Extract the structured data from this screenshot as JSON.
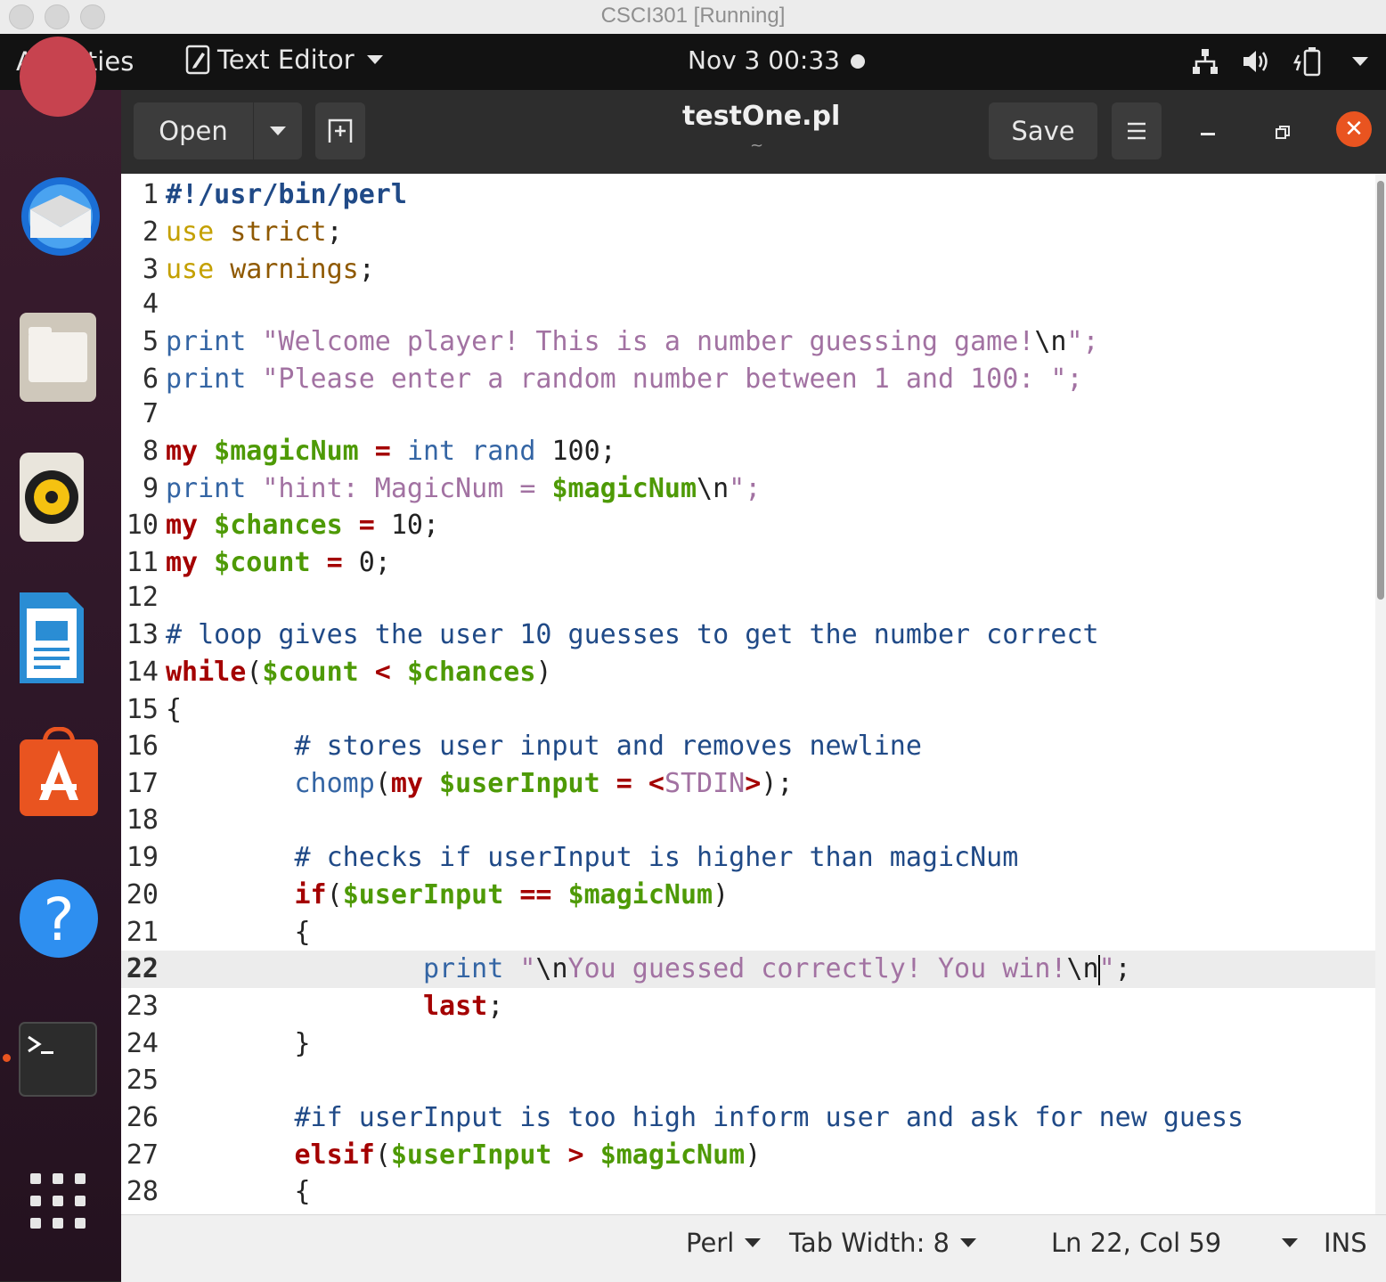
{
  "window": {
    "title": "CSCI301 [Running]"
  },
  "topbar": {
    "activities": "Activities",
    "app_name": "Text Editor",
    "clock": "Nov 3  00:33"
  },
  "header": {
    "open_label": "Open",
    "filename": "testOne.pl",
    "subtitle": "~",
    "save_label": "Save"
  },
  "editor": {
    "current_line": 22,
    "lines": [
      {
        "n": "1"
      },
      {
        "n": "2"
      },
      {
        "n": "3"
      },
      {
        "n": "4"
      },
      {
        "n": "5"
      },
      {
        "n": "6"
      },
      {
        "n": "7"
      },
      {
        "n": "8"
      },
      {
        "n": "9"
      },
      {
        "n": "10"
      },
      {
        "n": "11"
      },
      {
        "n": "12"
      },
      {
        "n": "13"
      },
      {
        "n": "14"
      },
      {
        "n": "15"
      },
      {
        "n": "16"
      },
      {
        "n": "17"
      },
      {
        "n": "18"
      },
      {
        "n": "19"
      },
      {
        "n": "20"
      },
      {
        "n": "21"
      },
      {
        "n": "22"
      },
      {
        "n": "23"
      },
      {
        "n": "24"
      },
      {
        "n": "25"
      },
      {
        "n": "26"
      },
      {
        "n": "27"
      },
      {
        "n": "28"
      }
    ],
    "tokens": {
      "l1": "#!/usr/bin/perl",
      "l2a": "use",
      "l2b": " strict",
      "l2c": ";",
      "l3a": "use",
      "l3b": " warnings",
      "l3c": ";",
      "l5a": "print",
      "l5b": " \"Welcome player! This is a number guessing game!",
      "l5c": "\\n",
      "l5d": "\";",
      "l6a": "print",
      "l6b": " \"Please enter a random number between 1 and 100: ",
      "l6c": "\";",
      "l8a": "my",
      "l8b": " $magicNum",
      "l8c": " = ",
      "l8d": "int rand",
      "l8e": " 100;",
      "l9a": "print",
      "l9b": " \"hint: MagicNum = ",
      "l9c": "$magicNum",
      "l9d": "\\n",
      "l9e": "\";",
      "l10a": "my",
      "l10b": " $chances",
      "l10c": " = ",
      "l10d": "10;",
      "l11a": "my",
      "l11b": " $count",
      "l11c": " = ",
      "l11d": "0;",
      "l13": "# loop gives the user 10 guesses to get the number correct",
      "l14a": "while",
      "l14b": "(",
      "l14c": "$count",
      "l14d": " < ",
      "l14e": "$chances",
      "l14f": ")",
      "l15": "{",
      "l16": "        # stores user input and removes newline",
      "l17a": "        chomp",
      "l17b": "(",
      "l17c": "my",
      "l17d": " $userInput",
      "l17e": " = ",
      "l17f": "<",
      "l17g": "STDIN",
      "l17h": ">",
      "l17i": ");",
      "l19": "        # checks if userInput is higher than magicNum",
      "l20a": "        if",
      "l20b": "(",
      "l20c": "$userInput",
      "l20d": " == ",
      "l20e": "$magicNum",
      "l20f": ")",
      "l21": "        {",
      "l22a": "                print",
      "l22b": " \"",
      "l22c": "\\n",
      "l22d": "You guessed correctly! You win!",
      "l22e": "\\n",
      "l22f": "\"",
      "l22g": ";",
      "l23a": "                last",
      "l23b": ";",
      "l24": "        }",
      "l26": "        #if userInput is too high inform user and ask for new guess",
      "l27a": "        elsif",
      "l27b": "(",
      "l27c": "$userInput",
      "l27d": " > ",
      "l27e": "$magicNum",
      "l27f": ")",
      "l28": "        {"
    }
  },
  "statusbar": {
    "language": "Perl",
    "tab_width": "Tab Width: 8",
    "position": "Ln 22, Col 59",
    "mode": "INS"
  },
  "colors": {
    "keyword": "#a40000",
    "variable": "#4e9a06",
    "string": "#a272a2",
    "function": "#3465a4",
    "comment": "#204a87",
    "accent": "#e95420"
  },
  "dock": {
    "icons": [
      "thunderbird-icon",
      "files-icon",
      "rhythmbox-icon",
      "libreoffice-impress-icon",
      "software-center-icon",
      "help-icon",
      "terminal-icon",
      "show-apps-icon"
    ]
  }
}
